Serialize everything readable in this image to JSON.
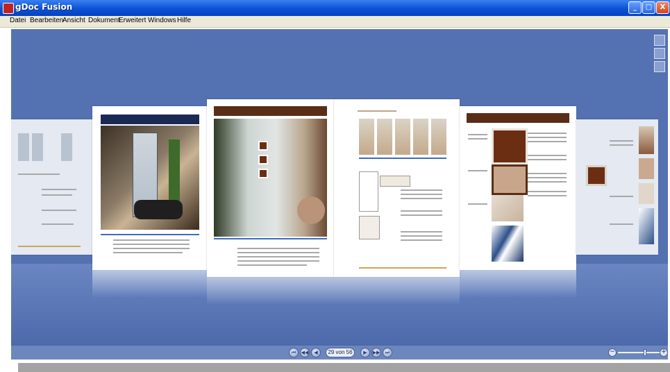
{
  "window": {
    "title": "gDoc Fusion",
    "minimize": "_",
    "maximize": "□",
    "close": "X"
  },
  "menu": [
    "Datei",
    "Bearbeiten",
    "Ansicht",
    "Dokument",
    "Erweitert",
    "Windows",
    "Hilfe"
  ],
  "navigation": {
    "page_counter": "29 von 56",
    "first": "⏮",
    "prev2": "◀◀",
    "prev": "◀",
    "next": "▶",
    "next2": "▶▶",
    "last": "⏭"
  },
  "zoom": {
    "minus": "−",
    "plus": "+",
    "level": 0.65
  },
  "side_buttons": [
    "single-page-view-icon",
    "thumbnail-grid-icon",
    "fullscreen-icon"
  ],
  "colors": {
    "viewer_bg": "#5472b1",
    "brown_header": "#5a2d16",
    "navy_header": "#1a2a55",
    "accent_blue": "#0a52d6"
  }
}
